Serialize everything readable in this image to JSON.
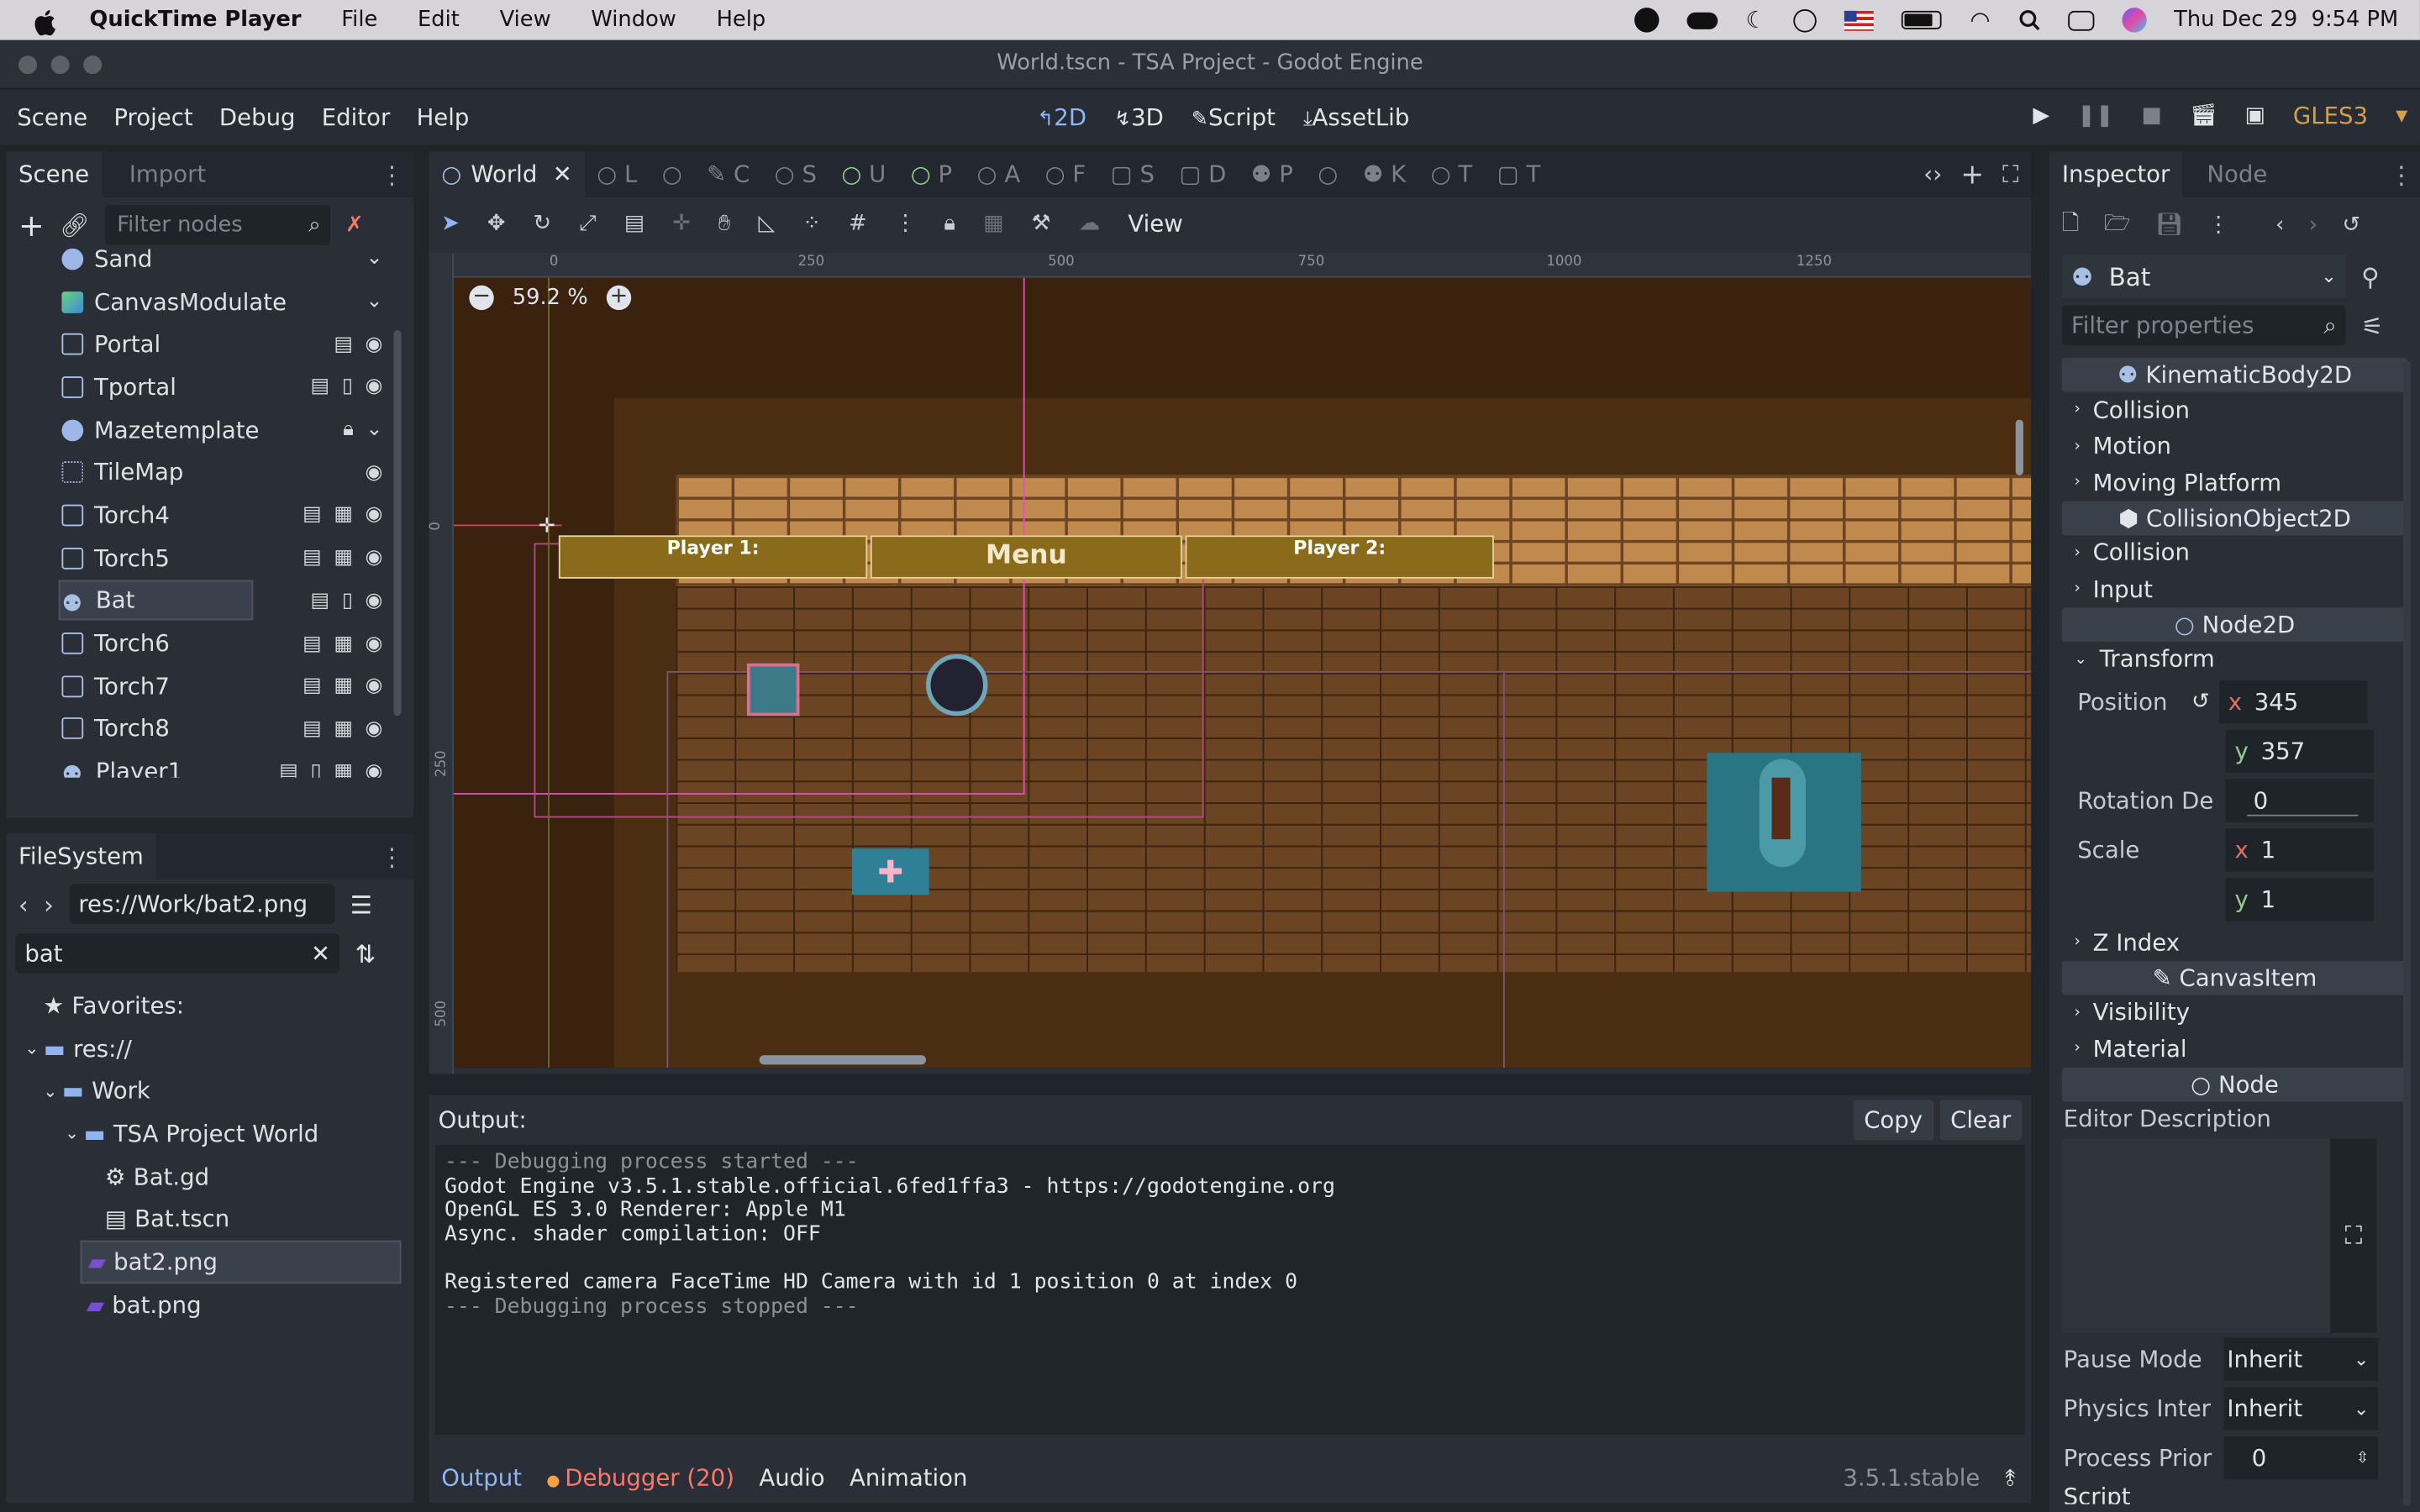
{
  "macbar": {
    "apple": "",
    "app": "QuickTime Player",
    "menus": [
      "File",
      "Edit",
      "View",
      "Window",
      "Help"
    ],
    "clock": "Thu Dec 29  9:54 PM"
  },
  "window": {
    "title": "World.tscn - TSA Project - Godot Engine"
  },
  "godot_menu": {
    "items": [
      "Scene",
      "Project",
      "Debug",
      "Editor",
      "Help"
    ],
    "modes": [
      "2D",
      "3D",
      "Script",
      "AssetLib"
    ],
    "renderer": "GLES3"
  },
  "scene_dock": {
    "tabs": [
      "Scene",
      "Import"
    ],
    "filter_placeholder": "Filter nodes",
    "nodes": [
      {
        "name": "Sand"
      },
      {
        "name": "CanvasModulate"
      },
      {
        "name": "Portal"
      },
      {
        "name": "Tportal"
      },
      {
        "name": "Mazetemplate"
      },
      {
        "name": "TileMap"
      },
      {
        "name": "Torch4"
      },
      {
        "name": "Torch5"
      },
      {
        "name": "Bat"
      },
      {
        "name": "Torch6"
      },
      {
        "name": "Torch7"
      },
      {
        "name": "Torch8"
      },
      {
        "name": "Player1"
      }
    ]
  },
  "filesystem": {
    "tab": "FileSystem",
    "path": "res://Work/bat2.png",
    "search": "bat",
    "items": [
      {
        "label": "Favorites:"
      },
      {
        "label": "res://"
      },
      {
        "label": "Work"
      },
      {
        "label": "TSA Project World"
      },
      {
        "label": "Bat.gd"
      },
      {
        "label": "Bat.tscn"
      },
      {
        "label": "bat2.png"
      },
      {
        "label": "bat.png"
      }
    ]
  },
  "viewport": {
    "scene_tabs": [
      "World",
      "L",
      "",
      "C",
      "S",
      "U",
      "P",
      "A",
      "F",
      "S",
      "D",
      "P",
      "",
      "K",
      "T",
      "T"
    ],
    "toolbar_view": "View",
    "zoom": "59.2 %",
    "ruler_ticks": [
      "0",
      "250",
      "500",
      "750",
      "1000",
      "1250"
    ],
    "ruler_v_ticks": [
      "0",
      "250",
      "500"
    ],
    "hud": {
      "p1": "Player 1:",
      "menu": "Menu",
      "p2": "Player 2:"
    }
  },
  "output": {
    "title": "Output:",
    "copy": "Copy",
    "clear": "Clear",
    "lines": [
      "--- Debugging process started ---",
      "Godot Engine v3.5.1.stable.official.6fed1ffa3 - https://godotengine.org",
      "OpenGL ES 3.0 Renderer: Apple M1",
      "Async. shader compilation: OFF",
      "",
      "Registered camera FaceTime HD Camera with id 1 position 0 at index 0",
      "--- Debugging process stopped ---"
    ],
    "bottom_tabs": [
      "Output",
      "Debugger (20)",
      "Audio",
      "Animation"
    ],
    "version": "3.5.1.stable"
  },
  "inspector": {
    "tabs": [
      "Inspector",
      "Node"
    ],
    "node": "Bat",
    "filter_placeholder": "Filter properties",
    "sections": {
      "kb": "KinematicBody2D",
      "co": "CollisionObject2D",
      "n2d": "Node2D",
      "ci": "CanvasItem",
      "node": "Node"
    },
    "kb_props": [
      "Collision",
      "Motion",
      "Moving Platform"
    ],
    "co_props": [
      "Collision",
      "Input"
    ],
    "transform": "Transform",
    "position": {
      "label": "Position",
      "x": "345",
      "y": "357"
    },
    "rotation": {
      "label": "Rotation De",
      "value": "0"
    },
    "scale": {
      "label": "Scale",
      "x": "1",
      "y": "1"
    },
    "zindex": "Z Index",
    "ci_props": [
      "Visibility",
      "Material"
    ],
    "editor_desc": "Editor Description",
    "pause": {
      "label": "Pause Mode",
      "value": "Inherit"
    },
    "physics": {
      "label": "Physics Inter",
      "value": "Inherit"
    },
    "priority": {
      "label": "Process Prior",
      "value": "0"
    },
    "script_cut": "Script"
  },
  "colors": {
    "accent": "#8eb6f5",
    "debugger": "#ff786b",
    "selected": "#3b414c",
    "hud_gold": "#8a6b1c"
  }
}
